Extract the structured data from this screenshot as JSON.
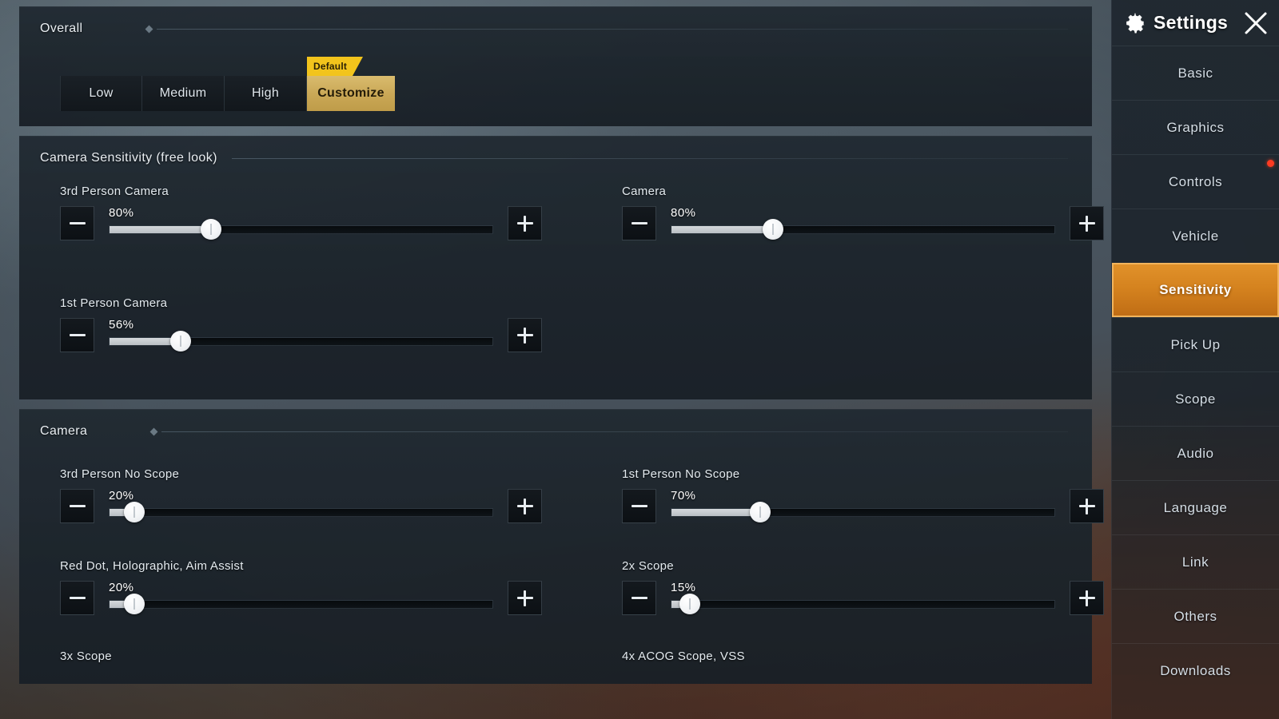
{
  "sidebar": {
    "title": "Settings",
    "gear_icon": "gear-icon",
    "close_icon": "close-icon",
    "active_color": "#d5831f",
    "badge_color": "#ff3b22",
    "items": [
      {
        "label": "Basic",
        "active": false,
        "badge": false
      },
      {
        "label": "Graphics",
        "active": false,
        "badge": false
      },
      {
        "label": "Controls",
        "active": false,
        "badge": true
      },
      {
        "label": "Vehicle",
        "active": false,
        "badge": false
      },
      {
        "label": "Sensitivity",
        "active": true,
        "badge": false
      },
      {
        "label": "Pick Up",
        "active": false,
        "badge": false
      },
      {
        "label": "Scope",
        "active": false,
        "badge": false
      },
      {
        "label": "Audio",
        "active": false,
        "badge": false
      },
      {
        "label": "Language",
        "active": false,
        "badge": false
      },
      {
        "label": "Link",
        "active": false,
        "badge": false
      },
      {
        "label": "Others",
        "active": false,
        "badge": false
      },
      {
        "label": "Downloads",
        "active": false,
        "badge": false
      }
    ]
  },
  "overall": {
    "title": "Overall",
    "ribbon_label": "Default",
    "ribbon_color": "#f2c41c",
    "selected_color": "#c9a755",
    "presets": [
      {
        "label": "Low",
        "selected": false
      },
      {
        "label": "Medium",
        "selected": false
      },
      {
        "label": "High",
        "selected": false
      },
      {
        "label": "Customize",
        "selected": true
      }
    ]
  },
  "free_look": {
    "title": "Camera Sensitivity (free look)",
    "fields": [
      {
        "label": "3rd Person Camera",
        "value": "80%",
        "percent": 80,
        "column": "left",
        "row": 0
      },
      {
        "label": "Camera",
        "value": "80%",
        "percent": 80,
        "column": "right",
        "row": 0
      },
      {
        "label": "1st Person Camera",
        "value": "56%",
        "percent": 56,
        "column": "left",
        "row": 1
      }
    ]
  },
  "camera": {
    "title": "Camera",
    "fields": [
      {
        "label": "3rd Person No Scope",
        "value": "20%",
        "percent": 20,
        "column": "left",
        "row": 0
      },
      {
        "label": "1st Person No Scope",
        "value": "70%",
        "percent": 70,
        "column": "right",
        "row": 0
      },
      {
        "label": "Red Dot, Holographic, Aim Assist",
        "value": "20%",
        "percent": 20,
        "column": "left",
        "row": 1
      },
      {
        "label": "2x Scope",
        "value": "15%",
        "percent": 15,
        "column": "right",
        "row": 1
      },
      {
        "label": "3x Scope",
        "value": "",
        "percent": null,
        "column": "left",
        "row": 2
      },
      {
        "label": "4x ACOG Scope, VSS",
        "value": "",
        "percent": null,
        "column": "right",
        "row": 2
      }
    ]
  },
  "slider_scale_max": 300,
  "icons": {
    "minus": "minus-icon",
    "plus": "plus-icon",
    "diamond": "diamond-icon"
  }
}
